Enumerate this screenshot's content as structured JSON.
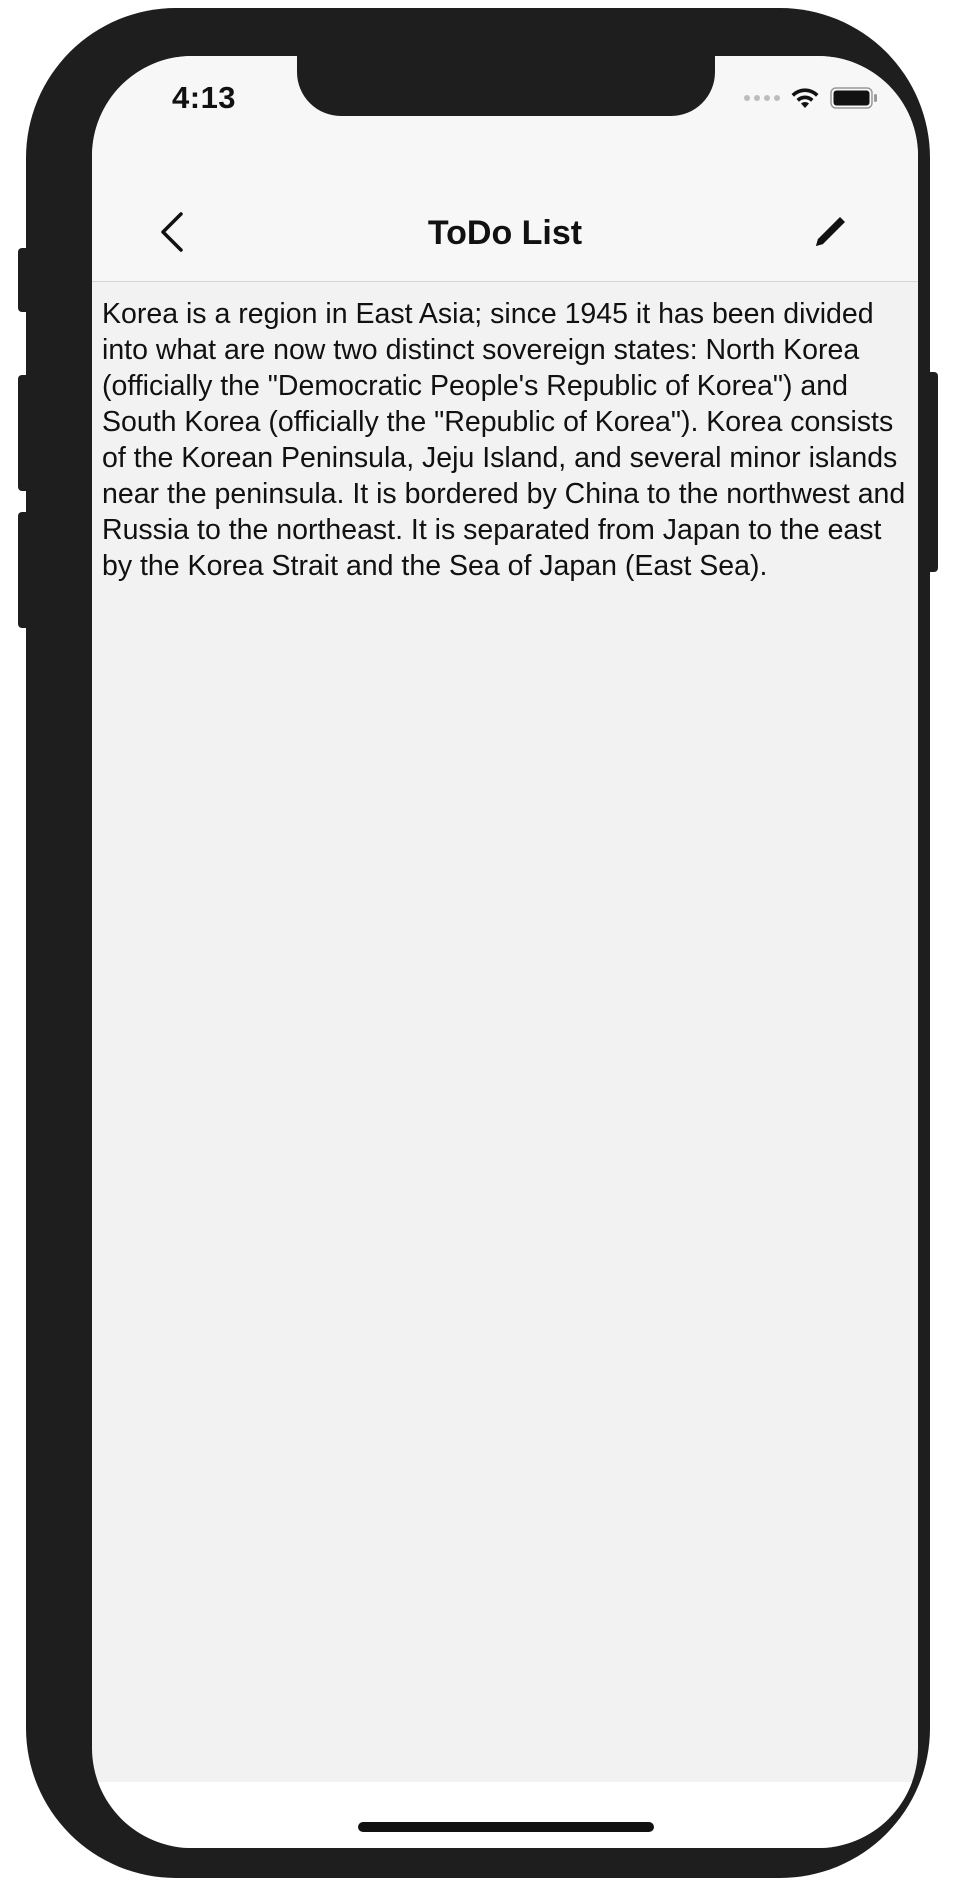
{
  "status_bar": {
    "time": "4:13",
    "icons": [
      "cellular-signal-icon",
      "wifi-icon",
      "battery-icon"
    ]
  },
  "nav_bar": {
    "title": "ToDo List",
    "back_icon": "chevron-left-icon",
    "edit_icon": "pencil-icon"
  },
  "content": {
    "text": "Korea is a region in East Asia; since 1945 it has been divided into what are now two distinct sovereign states: North Korea (officially the \"Democratic People's Republic of Korea\") and South Korea (officially the \"Republic of Korea\"). Korea consists of the Korean Peninsula, Jeju Island, and several minor islands near the peninsula. It is bordered by China to the northwest and Russia to the northeast. It is separated from Japan to the east by the Korea Strait and the Sea of Japan (East Sea)."
  },
  "colors": {
    "background": "#f2f2f2",
    "nav_background": "#f7f7f7",
    "text": "#111111",
    "frame": "#1e1e1f"
  }
}
